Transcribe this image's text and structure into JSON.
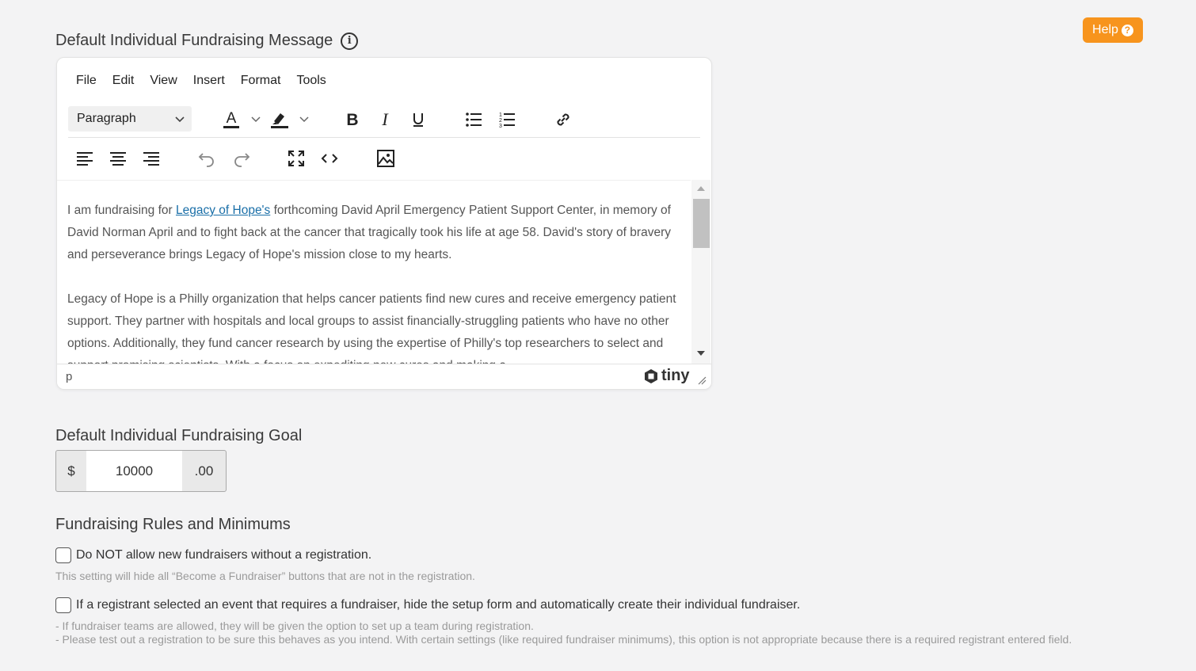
{
  "help": {
    "label": "Help",
    "icon": "question-circle-icon"
  },
  "message_section": {
    "title": "Default Individual Fundraising Message",
    "info_icon": "i"
  },
  "editor": {
    "menu": [
      "File",
      "Edit",
      "View",
      "Insert",
      "Format",
      "Tools"
    ],
    "block_format": "Paragraph",
    "content": {
      "p1_before_link": "I am fundraising for ",
      "p1_link": "Legacy of Hope's",
      "p1_after_link": " forthcoming David April Emergency Patient Support Center,  in memory of David Norman April and to fight back at the cancer that tragically took his life at age 58. David's story of bravery and perseverance brings Legacy of Hope's mission close to my hearts.",
      "p2": "Legacy of Hope is a Philly organization that helps cancer patients find new cures and receive emergency patient support. They partner with hospitals and local groups to assist financially-struggling patients who have no other options. Additionally, they fund cancer research by using the expertise of Philly's top researchers to select and support promising scientists. With a focus on expediting new cures and making a"
    },
    "status_path": "p",
    "brand": "tiny"
  },
  "goal_section": {
    "title": "Default Individual Fundraising Goal",
    "currency": "$",
    "value": "10000",
    "cents": ".00"
  },
  "rules_section": {
    "title": "Fundraising Rules and Minimums",
    "rule1": {
      "label": "Do NOT allow new fundraisers without a registration.",
      "hint": "This setting will hide all “Become a Fundraiser” buttons that are not in the registration."
    },
    "rule2": {
      "label": "If a registrant selected an event that requires a fundraiser, hide the setup form and automatically create their individual fundraiser.",
      "hint1": "- If fundraiser teams are allowed, they will be given the option to set up a team during registration.",
      "hint2": "- Please test out a registration to be sure this behaves as you intend. With certain settings (like required fundraiser minimums), this option is not appropriate because there is a required registrant entered field."
    }
  },
  "colors": {
    "accent": "#f7941d",
    "link": "#1a6fa8",
    "background": "#f3f3f4"
  }
}
